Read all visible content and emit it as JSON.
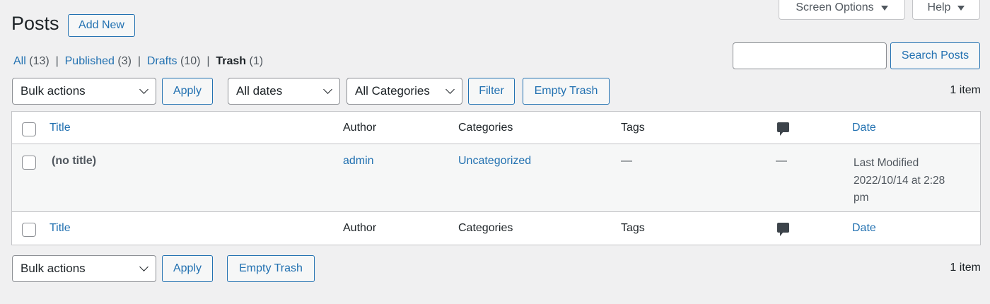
{
  "header": {
    "title": "Posts",
    "add_new": "Add New",
    "screen_options": "Screen Options",
    "help": "Help"
  },
  "views": [
    {
      "label": "All",
      "count": "(13)"
    },
    {
      "label": "Published",
      "count": "(3)"
    },
    {
      "label": "Drafts",
      "count": "(10)"
    },
    {
      "label": "Trash",
      "count": "(1)"
    }
  ],
  "search": {
    "value": "",
    "button": "Search Posts"
  },
  "top_nav": {
    "bulk": "Bulk actions",
    "apply": "Apply",
    "dates": "All dates",
    "categories": "All Categories",
    "filter": "Filter",
    "empty_trash": "Empty Trash",
    "count": "1 item"
  },
  "columns": {
    "title": "Title",
    "author": "Author",
    "categories": "Categories",
    "tags": "Tags",
    "date": "Date"
  },
  "rows": [
    {
      "title": "(no title)",
      "author": "admin",
      "categories": "Uncategorized",
      "tags": "—",
      "comments": "—",
      "date_status": "Last Modified",
      "date": "2022/10/14 at 2:28",
      "date_suffix": "pm"
    }
  ],
  "bottom_nav": {
    "bulk": "Bulk actions",
    "apply": "Apply",
    "empty_trash": "Empty Trash",
    "count": "1 item"
  }
}
